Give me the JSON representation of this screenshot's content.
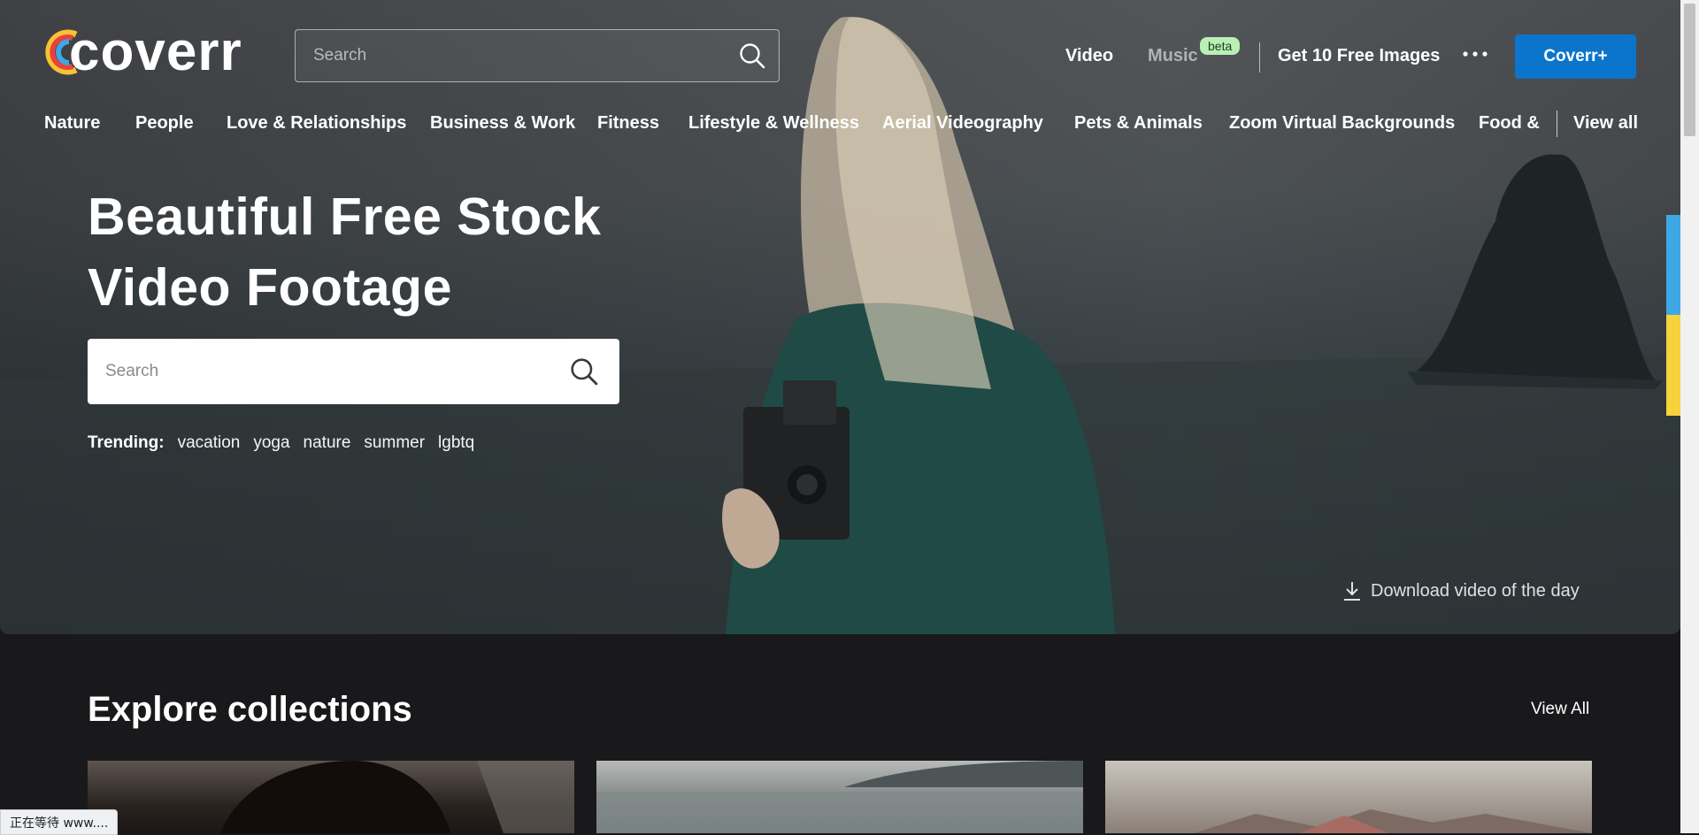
{
  "header": {
    "logo_text": "coverr",
    "search_placeholder": "Search",
    "nav": {
      "video": "Video",
      "music": "Music",
      "beta": "beta",
      "free_images": "Get 10 Free Images",
      "coverr_plus": "Coverr+"
    }
  },
  "categories": {
    "items": [
      "Nature",
      "People",
      "Love & Relationships",
      "Business & Work",
      "Fitness",
      "Lifestyle & Wellness",
      "Aerial Videography",
      "Pets & Animals",
      "Zoom Virtual Backgrounds",
      "Food &"
    ],
    "view_all": "View all"
  },
  "hero": {
    "title_line1": "Beautiful Free Stock",
    "title_line2": "Video Footage",
    "search_placeholder": "Search",
    "trending_label": "Trending:",
    "trending_tags": [
      "vacation",
      "yoga",
      "nature",
      "summer",
      "lgbtq"
    ],
    "download_label": "Download video of the day"
  },
  "explore": {
    "title": "Explore collections",
    "view_all": "View All"
  },
  "status_bar": {
    "text": "正在等待 www...."
  },
  "colors": {
    "accent": "#0b75cc",
    "beta_badge": "#b9f0b5",
    "page_bg": "#19181b"
  }
}
